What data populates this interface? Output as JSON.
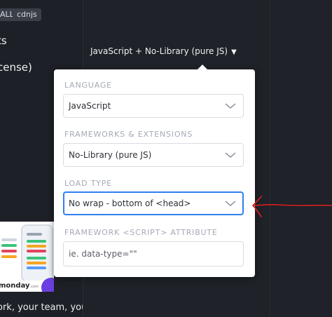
{
  "left_pane": {
    "tags": [
      "ALL",
      "cdnjs"
    ],
    "lines": [
      "ts",
      "cense)"
    ],
    "ad": {
      "brand": "monday",
      "brand_suffix": ".com",
      "copy": "ork, your team, your"
    }
  },
  "selector": {
    "label": "JavaScript + No-Library (pure JS)",
    "caret": "▼"
  },
  "popover": {
    "language": {
      "label": "LANGUAGE",
      "value": "JavaScript"
    },
    "frameworks": {
      "label": "FRAMEWORKS & EXTENSIONS",
      "value": "No-Library (pure JS)"
    },
    "load_type": {
      "label": "LOAD TYPE",
      "value": "No wrap - bottom of <head>"
    },
    "script_attr": {
      "label": "FRAMEWORK <SCRIPT> ATTRIBUTE",
      "placeholder": "ie. data-type=\"\""
    }
  },
  "colors": {
    "background": "#1f2228",
    "accent_focus": "#2f7ff0",
    "annotation": "#d81f1f",
    "popover_bg": "#ffffff"
  },
  "icons": [
    "chevron-down-icon",
    "caret-down-icon",
    "annotation-arrow-icon"
  ]
}
